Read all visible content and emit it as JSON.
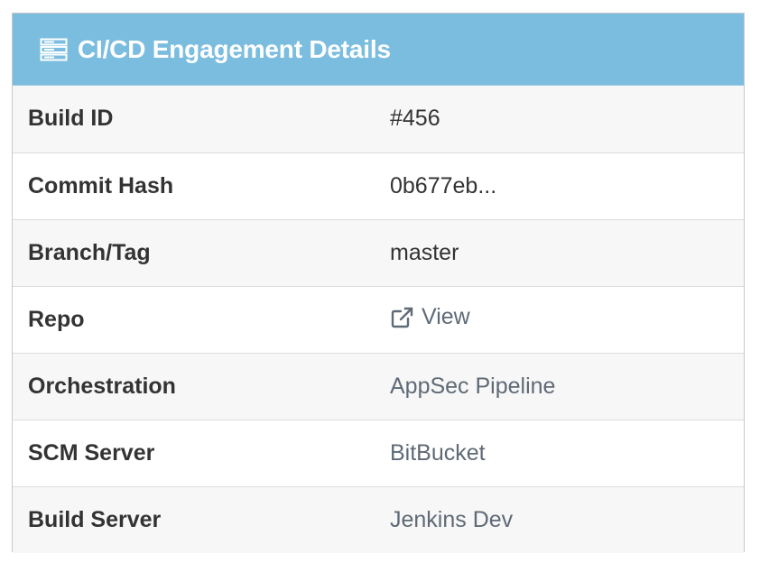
{
  "panel": {
    "title": "CI/CD Engagement Details",
    "icon": "server-icon"
  },
  "details": {
    "rows": [
      {
        "label": "Build ID",
        "value": "#456",
        "kind": "text"
      },
      {
        "label": "Commit Hash",
        "value": "0b677eb...",
        "kind": "text"
      },
      {
        "label": "Branch/Tag",
        "value": "master",
        "kind": "text"
      },
      {
        "label": "Repo",
        "value": "View",
        "kind": "external-link",
        "icon": "external-link-icon"
      },
      {
        "label": "Orchestration",
        "value": "AppSec Pipeline",
        "kind": "link"
      },
      {
        "label": "SCM Server",
        "value": "BitBucket",
        "kind": "link"
      },
      {
        "label": "Build Server",
        "value": "Jenkins Dev",
        "kind": "link"
      }
    ]
  },
  "colors": {
    "header_bg": "#7bbddf",
    "header_text": "#ffffff",
    "label_text": "#333333",
    "link_text": "#5f6a76",
    "row_alt_bg": "#f7f7f7"
  }
}
